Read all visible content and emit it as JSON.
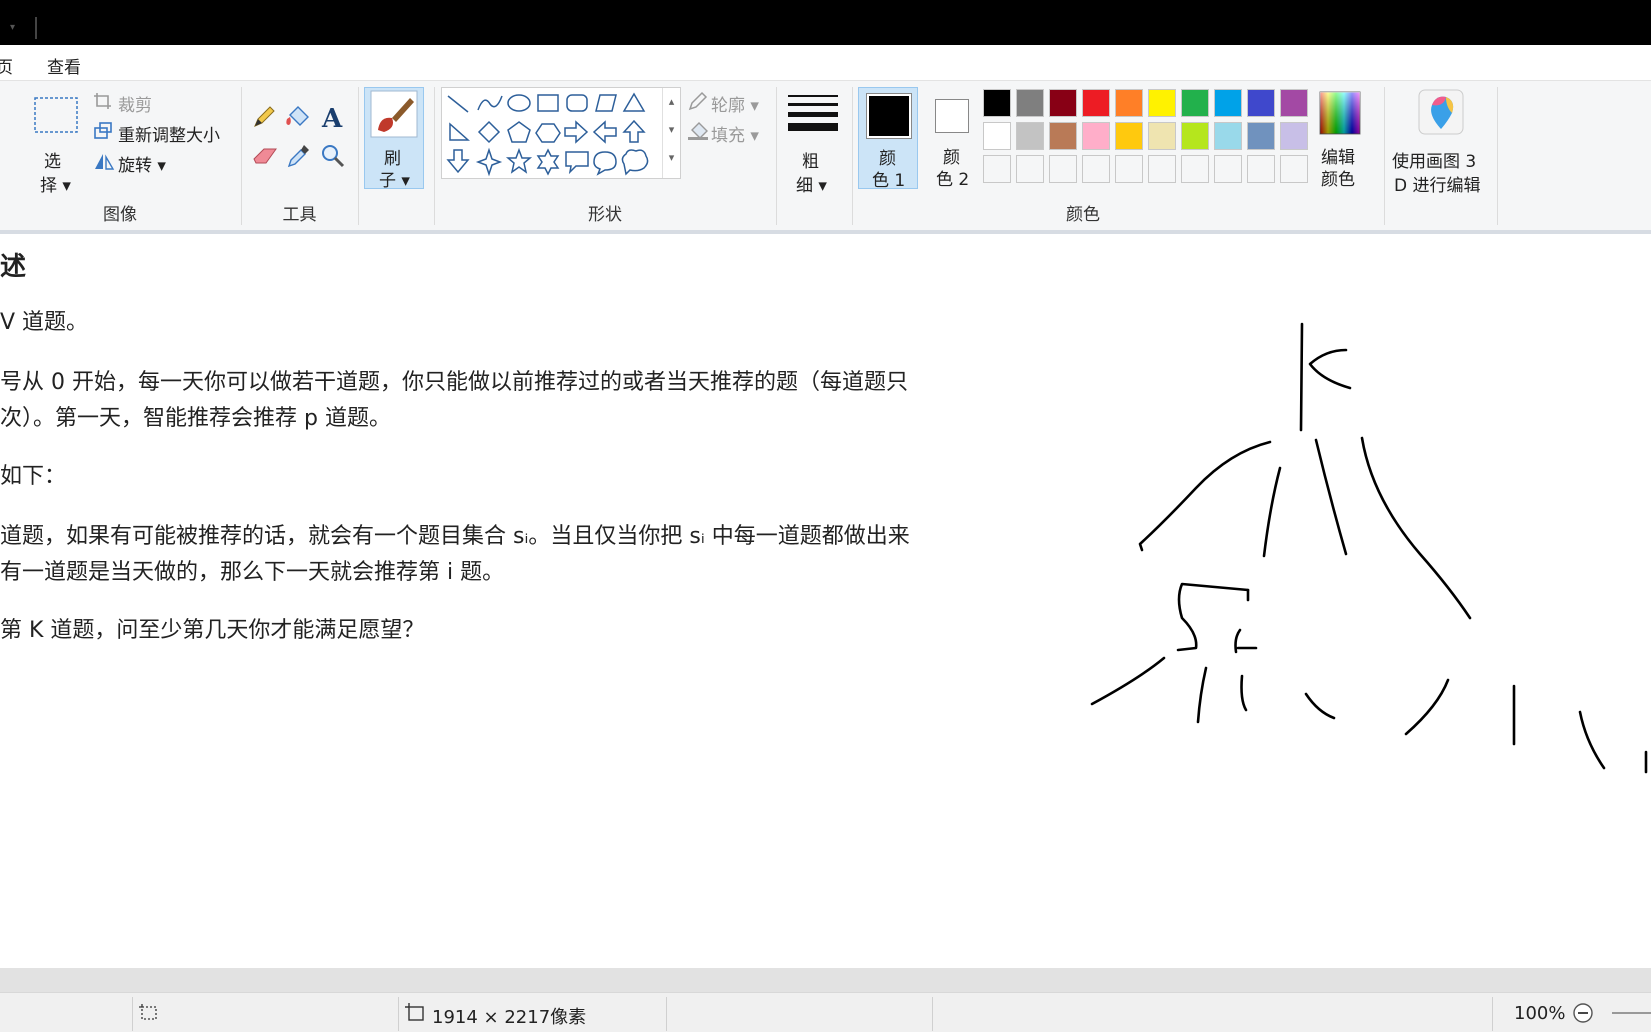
{
  "tabs": {
    "partial_left": "页",
    "view": "查看"
  },
  "image_group": {
    "select_line1": "选",
    "select_line2": "择",
    "crop": "裁剪",
    "resize": "重新调整大小",
    "rotate": "旋转",
    "label": "图像"
  },
  "tools_group": {
    "label": "工具"
  },
  "brush": {
    "line1": "刷",
    "line2": "子"
  },
  "shapes_group": {
    "outline": "轮廓",
    "fill": "填充",
    "label": "形状"
  },
  "size": {
    "line1": "粗",
    "line2": "细"
  },
  "colors_group": {
    "color1_line1": "颜",
    "color1_line2": "色 1",
    "color2_line1": "颜",
    "color2_line2": "色 2",
    "edit_line1": "编辑",
    "edit_line2": "颜色",
    "label": "颜色",
    "palette_row1": [
      "#000000",
      "#7f7f7f",
      "#880015",
      "#ed1c24",
      "#ff7f27",
      "#fff200",
      "#22b14c",
      "#00a2e8",
      "#3f48cc",
      "#a349a4"
    ],
    "palette_row2": [
      "#ffffff",
      "#c3c3c3",
      "#b97a57",
      "#ffaec9",
      "#ffc90e",
      "#efe4b0",
      "#b5e61d",
      "#99d9ea",
      "#7092be",
      "#c8bfe7"
    ]
  },
  "paint3d": {
    "line1": "使用画图 3",
    "line2": "D 进行编辑"
  },
  "canvas_text": {
    "heading": "述",
    "line1": "V 道题。",
    "line2": "号从 0 开始，每一天你可以做若干道题，你只能做以前推荐过的或者当天推荐的题（每道题只",
    "line3": "次）。第一天，智能推荐会推荐 p 道题。",
    "line4": "如下：",
    "line5": "道题，如果有可能被推荐的话，就会有一个题目集合 sᵢ。当且仅当你把 sᵢ 中每一道题都做出来",
    "line6": "有一道题是当天做的，那么下一天就会推荐第 i 题。",
    "line7": "第 K 道题，问至少第几天你才能满足愿望？"
  },
  "status": {
    "dimensions": "1914 × 2217像素",
    "zoom": "100%"
  }
}
